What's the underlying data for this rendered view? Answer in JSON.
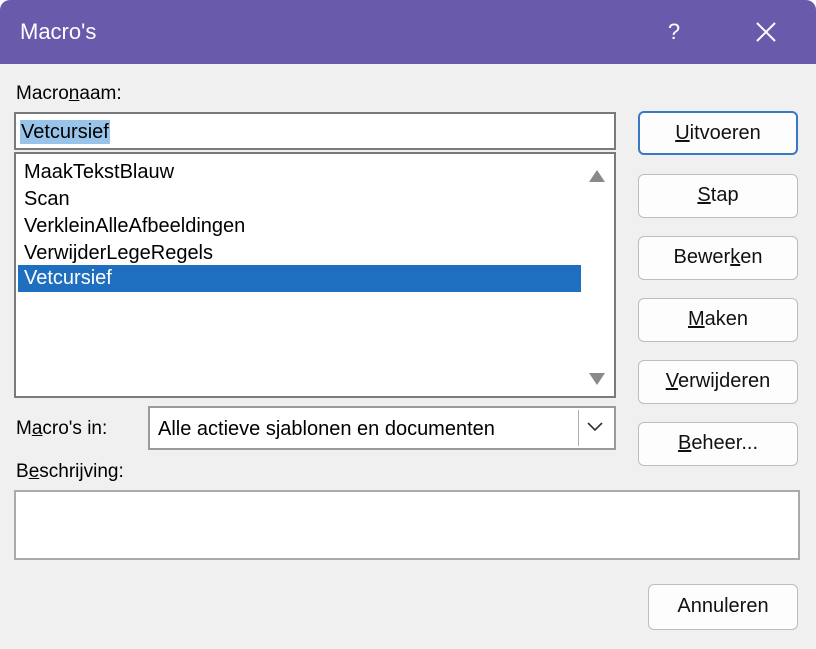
{
  "window": {
    "title": "Macro's",
    "help_label": "?"
  },
  "macro_name": {
    "label_pre": "Macro",
    "label_mnemonic": "n",
    "label_post": "aam:",
    "value": "Vetcursief"
  },
  "macro_list": {
    "items": [
      "MaakTekstBlauw",
      "Scan",
      "VerkleinAlleAfbeeldingen",
      "VerwijderLegeRegels",
      "Vetcursief"
    ],
    "selected": "Vetcursief"
  },
  "buttons": {
    "run": {
      "mnemonic": "U",
      "rest": "itvoeren"
    },
    "step": {
      "mnemonic": "S",
      "rest": "tap"
    },
    "edit": {
      "pre": "Bewer",
      "mnemonic": "k",
      "rest": "en"
    },
    "create": {
      "mnemonic": "M",
      "rest": "aken"
    },
    "delete": {
      "mnemonic": "V",
      "rest": "erwijderen"
    },
    "organizer": {
      "mnemonic": "B",
      "rest": "eheer..."
    },
    "cancel": "Annuleren"
  },
  "macros_in": {
    "label_pre": "M",
    "label_mnemonic": "a",
    "label_post": "cro's in:",
    "value": "Alle actieve sjablonen en documenten"
  },
  "description": {
    "label_pre": "B",
    "label_mnemonic": "e",
    "label_post": "schrijving:",
    "value": ""
  },
  "colors": {
    "titlebar": "#6a5aac",
    "selection": "#1e6fc0",
    "text_selection": "#99c4ea",
    "default_button_border": "#3a78c6"
  },
  "icons": {
    "close": "close-icon",
    "scroll_up": "triangle-up-icon",
    "scroll_down": "triangle-down-icon",
    "combo": "chevron-down-icon"
  }
}
